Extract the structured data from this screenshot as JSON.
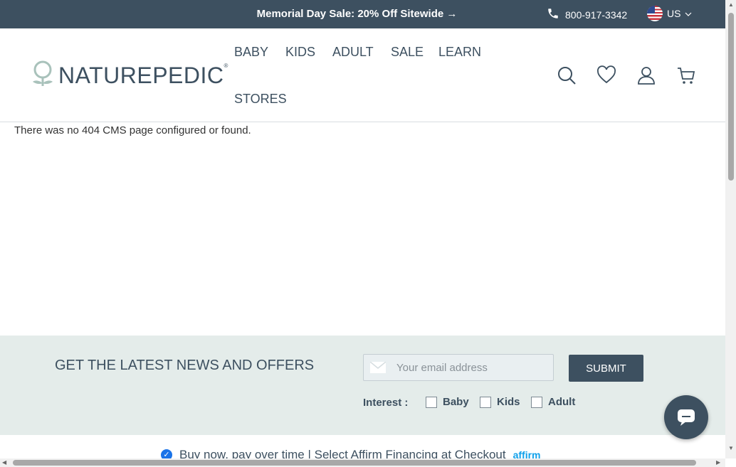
{
  "promo": {
    "text": "Memorial Day Sale: 20% Off Sitewide →",
    "phone": "800-917-3342",
    "country": "US"
  },
  "logo": {
    "text": "NATUREPEDIC",
    "mark": "®"
  },
  "nav": {
    "items": [
      {
        "label": "BABY"
      },
      {
        "label": "KIDS"
      },
      {
        "label": "ADULT"
      },
      {
        "label": "SALE"
      },
      {
        "label": "LEARN"
      },
      {
        "label": "STORES"
      }
    ]
  },
  "main": {
    "message": "There was no 404 CMS page configured or found."
  },
  "newsletter": {
    "title": "GET THE LATEST NEWS AND OFFERS",
    "email_placeholder": "Your email address",
    "submit_label": "SUBMIT",
    "interest_label": "Interest :",
    "options": [
      {
        "label": "Baby"
      },
      {
        "label": "Kids"
      },
      {
        "label": "Adult"
      }
    ]
  },
  "affirm": {
    "text": "Buy now, pay over time | Select Affirm Financing at Checkout",
    "logo": "affirm"
  },
  "colors": {
    "primary": "#3d5060",
    "newsletter_bg": "#e4ecea",
    "affirm_blue": "#0fa0ea"
  }
}
